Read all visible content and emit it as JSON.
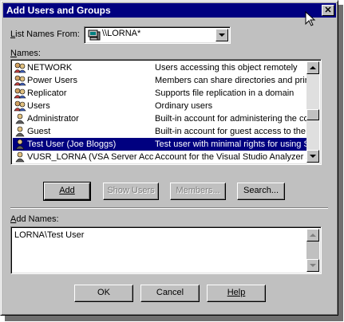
{
  "window": {
    "title": "Add Users and Groups",
    "close_label": "✕"
  },
  "list_names_from": {
    "label_pre": "",
    "label_ul": "L",
    "label_post": "ist Names From:",
    "value": "\\\\LORNA*"
  },
  "names": {
    "label_ul": "N",
    "label_post": "ames:",
    "rows": [
      {
        "name": "NETWORK",
        "description": "Users accessing this object remotely",
        "icon": "group-icon",
        "selected": false
      },
      {
        "name": "Power Users",
        "description": "Members can share directories and print",
        "icon": "group-icon",
        "selected": false
      },
      {
        "name": "Replicator",
        "description": "Supports file replication in a domain",
        "icon": "group-icon",
        "selected": false
      },
      {
        "name": "Users",
        "description": "Ordinary users",
        "icon": "group-icon",
        "selected": false
      },
      {
        "name": "Administrator",
        "description": "Built-in account for administering the cor",
        "icon": "user-icon",
        "selected": false
      },
      {
        "name": "Guest",
        "description": "Built-in account for guest access to the",
        "icon": "user-icon",
        "selected": false
      },
      {
        "name": "Test User (Joe Bloggs)",
        "description": "Test user with minimal rights for using SV",
        "icon": "user-icon",
        "selected": true
      },
      {
        "name": "VUSR_LORNA (VSA Server Acc",
        "description": "Account for the Visual Studio Analyzer s",
        "icon": "user-icon",
        "selected": false
      }
    ]
  },
  "buttons": {
    "add": "Add",
    "show_users": "Show Users",
    "members": "Members...",
    "search": "Search...",
    "ok": "OK",
    "cancel": "Cancel",
    "help": "Help"
  },
  "add_names": {
    "label_ul": "A",
    "label_post": "dd Names:",
    "value": "LORNA\\Test User"
  },
  "colors": {
    "title_bar": "#000080",
    "selection": "#000080",
    "face": "#c0c0c0"
  }
}
